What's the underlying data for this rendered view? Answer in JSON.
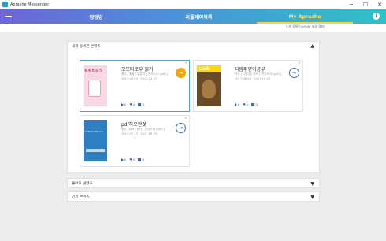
{
  "window": {
    "title": "Aprashe Messenger",
    "minimize": "─",
    "maximize": "☐",
    "close": "✕"
  },
  "tabs": [
    {
      "label": "업업맘",
      "active": false
    },
    {
      "label": "리플레이목록",
      "active": false
    },
    {
      "label": "My Aprashe",
      "active": true
    }
  ],
  "info_glyph": "i",
  "subheader_hint": "내게 등록된(ePUB/ 세상 정보)",
  "sections": {
    "mine": {
      "label": "내게 등록한 콘텐츠",
      "chevron": "▲"
    },
    "likes": {
      "label": "좋아요 콘텐츠",
      "chevron": "▼"
    },
    "popular": {
      "label": "인기 콘텐츠",
      "chevron": "▼"
    }
  },
  "cards": [
    {
      "title": "모모타로우 읽기",
      "subtitle": "종이 / 동화 / 일본어 [ 전자도서 (pdf) ]",
      "date": "2017-06-10 · 2017-11-07",
      "views": "0",
      "likes": "0",
      "comments": "0",
      "cover_text": "ももたろう",
      "action_icon": "⇥"
    },
    {
      "title": "다람쥐영어공부",
      "subtitle": "영어 / 다람쥐 / 아이 [ 전자도서 (pdf) ]",
      "date": "2017-06-06 · 2017-10-05",
      "views": "0",
      "likes": "0",
      "comments": "0",
      "cover_text": "Link",
      "action_icon": "⇥"
    },
    {
      "title": "pdf하오한것",
      "subtitle": "종이 / pdf / 문서 [ 전자도서 (pdf) ]",
      "date": "2017-07-12 · 2017-08-03",
      "views": "0",
      "likes": "0",
      "comments": "0",
      "cover_text": "epdf  Workflower",
      "action_icon": "⇥"
    }
  ],
  "colors": {
    "header_start": "#6f64d8",
    "header_end": "#2ec2c8",
    "active_tab": "#ffe066",
    "selected_border": "#4aa3d6",
    "action_filled": "#f5a600",
    "action_outline": "#3a66c4"
  }
}
